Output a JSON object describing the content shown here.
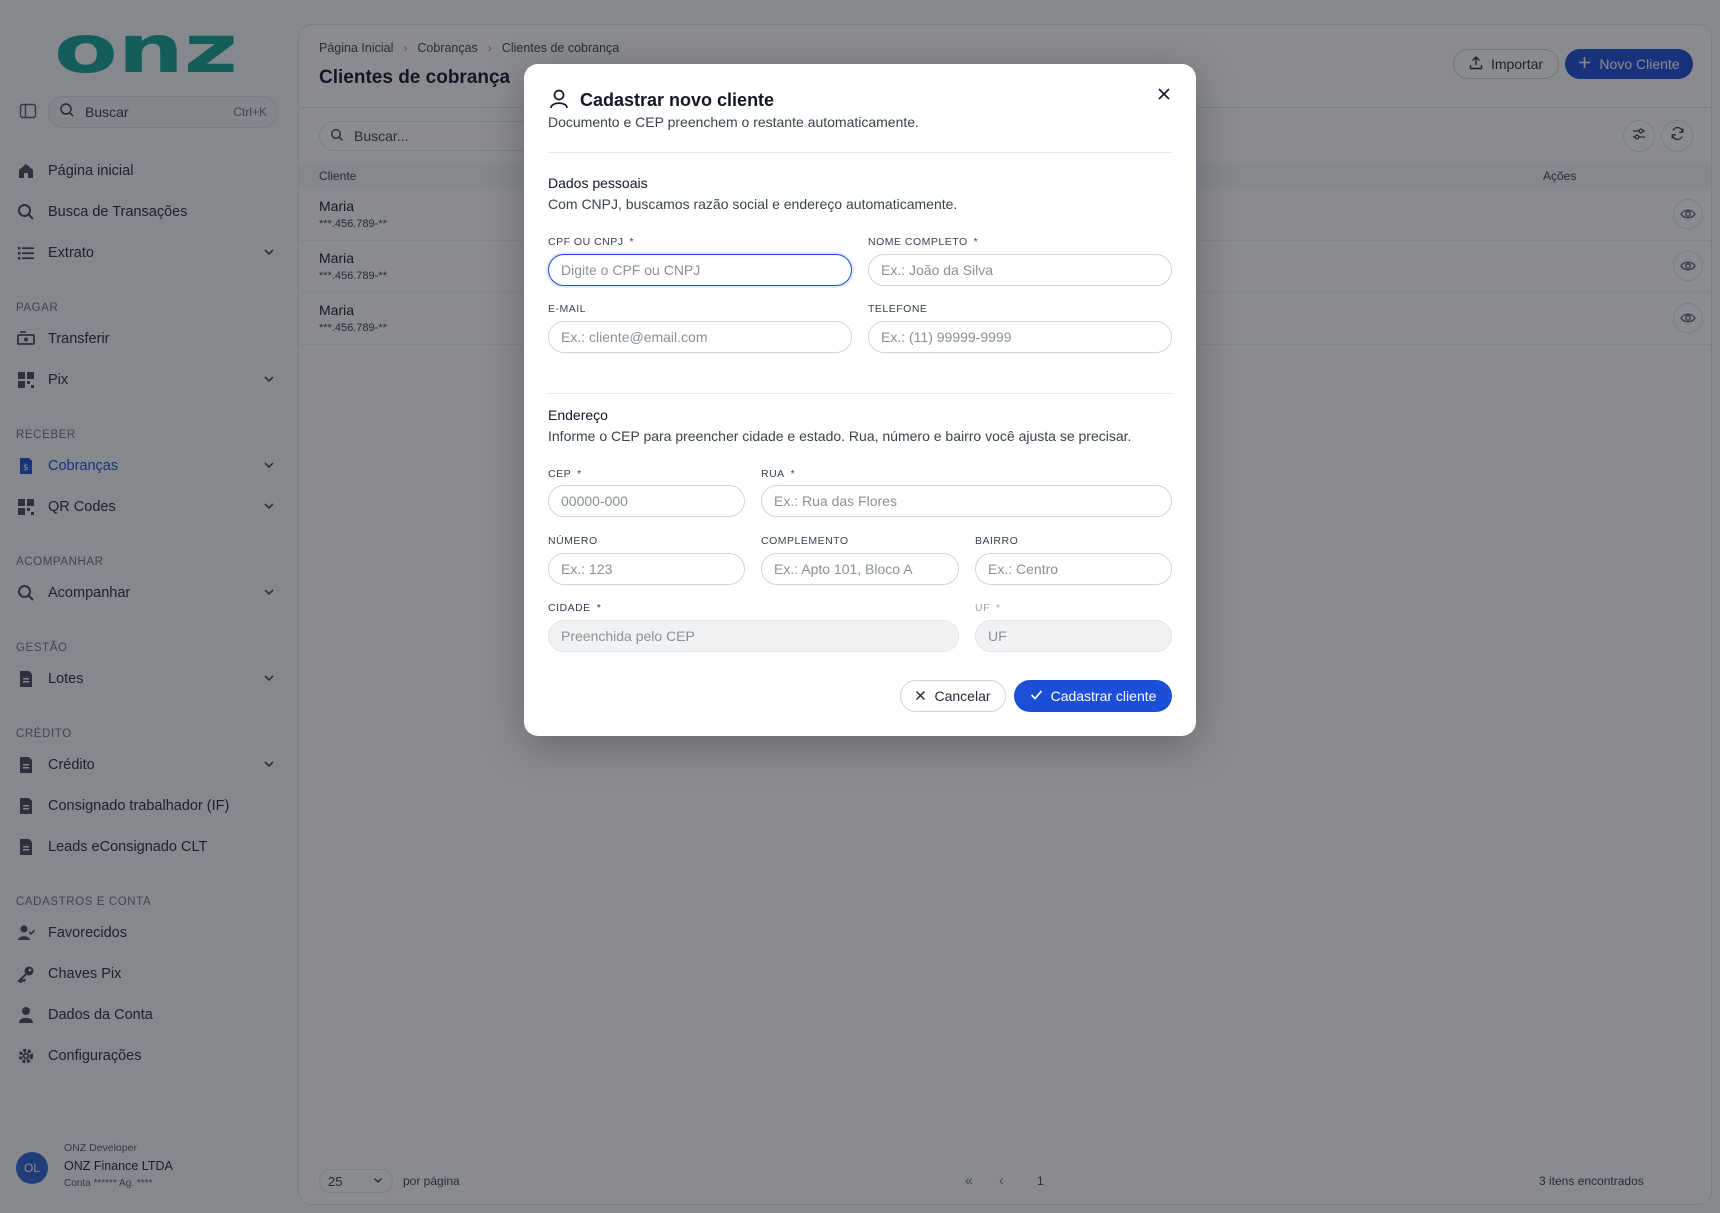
{
  "colors": {
    "accent": "#1d4ed8",
    "logo": "#12a596",
    "overlay": "#141820"
  },
  "sidebar": {
    "logo_text": "onz",
    "search": {
      "label": "Buscar",
      "shortcut": "Ctrl+K"
    },
    "items": {
      "home": "Página inicial",
      "transactions": "Busca de Transações",
      "statement": "Extrato",
      "transfer": "Transferir",
      "pix": "Pix",
      "charges": "Cobranças",
      "qrcodes": "QR Codes",
      "track": "Acompanhar",
      "batches": "Lotes",
      "credit": "Crédito",
      "payroll": "Consignado trabalhador (IF)",
      "leads": "Leads eConsignado CLT",
      "favorites": "Favorecidos",
      "pixkeys": "Chaves Pix",
      "account": "Dados da Conta",
      "settings": "Configurações"
    },
    "sections": {
      "pay": "PAGAR",
      "receive": "RECEBER",
      "follow": "ACOMPANHAR",
      "management": "GESTÃO",
      "credit": "CRÉDITO",
      "registry": "CADASTROS E CONTA"
    },
    "user": {
      "initials": "OL",
      "role": "ONZ Developer",
      "company": "ONZ Finance LTDA",
      "account": "Conta ****** Ag. ****"
    }
  },
  "main": {
    "breadcrumb": [
      "Página Inicial",
      "Cobranças",
      "Clientes de cobrança"
    ],
    "title": "Clientes de cobrança",
    "import_label": "Importar",
    "new_label": "Novo Cliente",
    "search_placeholder": "Buscar...",
    "table": {
      "col_client": "Cliente",
      "col_actions": "Ações",
      "rows": [
        {
          "name": "Maria",
          "doc": "***.456.789-**"
        },
        {
          "name": "Maria",
          "doc": "***.456.789-**"
        },
        {
          "name": "Maria",
          "doc": "***.456.789-**"
        }
      ]
    },
    "pager": {
      "page_size": "25",
      "per_page": "por página",
      "page": "1",
      "found": "3 itens encontrados"
    }
  },
  "modal": {
    "title": "Cadastrar novo cliente",
    "subtitle": "Documento e CEP preenchem o restante automaticamente.",
    "personal": {
      "title": "Dados pessoais",
      "desc": "Com CNPJ, buscamos razão social e endereço automaticamente.",
      "doc_label": "CPF OU CNPJ",
      "doc_placeholder": "Digite o CPF ou CNPJ",
      "name_label": "NOME COMPLETO",
      "name_placeholder": "Ex.: João da Silva",
      "email_label": "E-MAIL",
      "email_placeholder": "Ex.: cliente@email.com",
      "phone_label": "TELEFONE",
      "phone_placeholder": "Ex.: (11) 99999-9999"
    },
    "address": {
      "title": "Endereço",
      "desc": "Informe o CEP para preencher cidade e estado. Rua, número e bairro você ajusta se precisar.",
      "cep_label": "CEP",
      "cep_placeholder": "00000-000",
      "street_label": "RUA",
      "street_placeholder": "Ex.: Rua das Flores",
      "number_label": "NÚMERO",
      "number_placeholder": "Ex.: 123",
      "complement_label": "COMPLEMENTO",
      "complement_placeholder": "Ex.: Apto 101, Bloco A",
      "district_label": "BAIRRO",
      "district_placeholder": "Ex.: Centro",
      "city_label": "CIDADE",
      "city_placeholder": "Preenchida pelo CEP",
      "state_label": "UF",
      "state_placeholder": "UF"
    },
    "required_mark": "*",
    "cancel_label": "Cancelar",
    "submit_label": "Cadastrar cliente"
  }
}
